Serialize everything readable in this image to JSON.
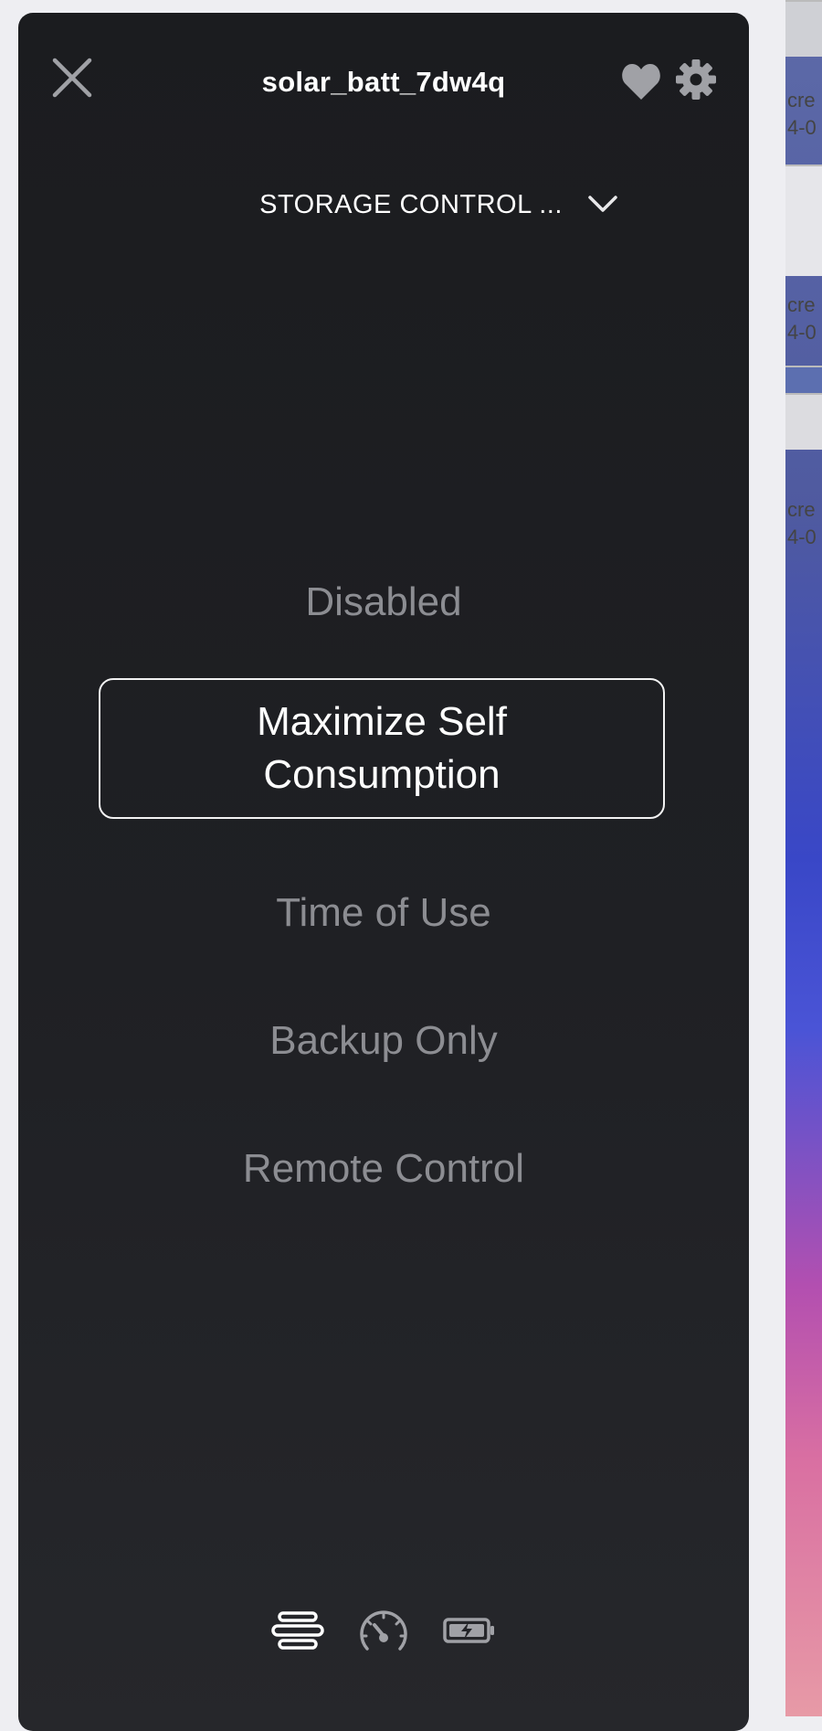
{
  "window": {
    "title": "solar_batt_7dw4q"
  },
  "header": {
    "mode_selector_label": "STORAGE CONTROL ..."
  },
  "options": [
    {
      "label": "Disabled",
      "selected": false
    },
    {
      "label": "Maximize Self Consumption",
      "selected": true
    },
    {
      "label": "Time of Use",
      "selected": false
    },
    {
      "label": "Backup Only",
      "selected": false
    },
    {
      "label": "Remote Control",
      "selected": false
    }
  ],
  "bottom_nav": [
    {
      "icon": "list-icon",
      "active": true
    },
    {
      "icon": "gauge-icon",
      "active": false
    },
    {
      "icon": "battery-charging-icon",
      "active": false
    }
  ],
  "background_desktop": {
    "labels": [
      "cre",
      "4-0",
      "cre",
      "4-0",
      "cre",
      "4-0"
    ]
  },
  "colors": {
    "panel_bg": "#1f2024",
    "text_primary": "#ffffff",
    "text_muted": "#8c8d92",
    "icon_muted": "#a0a1a6"
  }
}
